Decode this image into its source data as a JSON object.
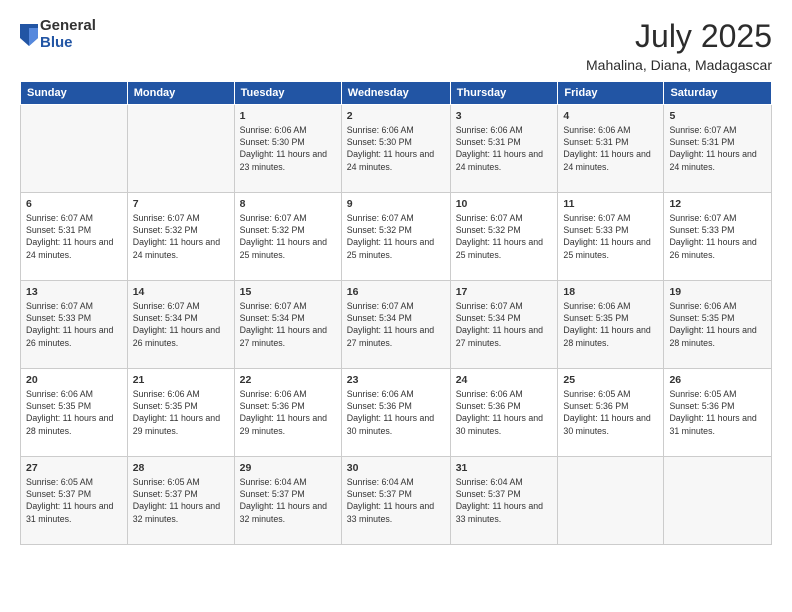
{
  "logo": {
    "general": "General",
    "blue": "Blue"
  },
  "header": {
    "month_year": "July 2025",
    "location": "Mahalina, Diana, Madagascar"
  },
  "weekdays": [
    "Sunday",
    "Monday",
    "Tuesday",
    "Wednesday",
    "Thursday",
    "Friday",
    "Saturday"
  ],
  "weeks": [
    [
      {
        "day": "",
        "info": ""
      },
      {
        "day": "",
        "info": ""
      },
      {
        "day": "1",
        "info": "Sunrise: 6:06 AM\nSunset: 5:30 PM\nDaylight: 11 hours and 23 minutes."
      },
      {
        "day": "2",
        "info": "Sunrise: 6:06 AM\nSunset: 5:30 PM\nDaylight: 11 hours and 24 minutes."
      },
      {
        "day": "3",
        "info": "Sunrise: 6:06 AM\nSunset: 5:31 PM\nDaylight: 11 hours and 24 minutes."
      },
      {
        "day": "4",
        "info": "Sunrise: 6:06 AM\nSunset: 5:31 PM\nDaylight: 11 hours and 24 minutes."
      },
      {
        "day": "5",
        "info": "Sunrise: 6:07 AM\nSunset: 5:31 PM\nDaylight: 11 hours and 24 minutes."
      }
    ],
    [
      {
        "day": "6",
        "info": "Sunrise: 6:07 AM\nSunset: 5:31 PM\nDaylight: 11 hours and 24 minutes."
      },
      {
        "day": "7",
        "info": "Sunrise: 6:07 AM\nSunset: 5:32 PM\nDaylight: 11 hours and 24 minutes."
      },
      {
        "day": "8",
        "info": "Sunrise: 6:07 AM\nSunset: 5:32 PM\nDaylight: 11 hours and 25 minutes."
      },
      {
        "day": "9",
        "info": "Sunrise: 6:07 AM\nSunset: 5:32 PM\nDaylight: 11 hours and 25 minutes."
      },
      {
        "day": "10",
        "info": "Sunrise: 6:07 AM\nSunset: 5:32 PM\nDaylight: 11 hours and 25 minutes."
      },
      {
        "day": "11",
        "info": "Sunrise: 6:07 AM\nSunset: 5:33 PM\nDaylight: 11 hours and 25 minutes."
      },
      {
        "day": "12",
        "info": "Sunrise: 6:07 AM\nSunset: 5:33 PM\nDaylight: 11 hours and 26 minutes."
      }
    ],
    [
      {
        "day": "13",
        "info": "Sunrise: 6:07 AM\nSunset: 5:33 PM\nDaylight: 11 hours and 26 minutes."
      },
      {
        "day": "14",
        "info": "Sunrise: 6:07 AM\nSunset: 5:34 PM\nDaylight: 11 hours and 26 minutes."
      },
      {
        "day": "15",
        "info": "Sunrise: 6:07 AM\nSunset: 5:34 PM\nDaylight: 11 hours and 27 minutes."
      },
      {
        "day": "16",
        "info": "Sunrise: 6:07 AM\nSunset: 5:34 PM\nDaylight: 11 hours and 27 minutes."
      },
      {
        "day": "17",
        "info": "Sunrise: 6:07 AM\nSunset: 5:34 PM\nDaylight: 11 hours and 27 minutes."
      },
      {
        "day": "18",
        "info": "Sunrise: 6:06 AM\nSunset: 5:35 PM\nDaylight: 11 hours and 28 minutes."
      },
      {
        "day": "19",
        "info": "Sunrise: 6:06 AM\nSunset: 5:35 PM\nDaylight: 11 hours and 28 minutes."
      }
    ],
    [
      {
        "day": "20",
        "info": "Sunrise: 6:06 AM\nSunset: 5:35 PM\nDaylight: 11 hours and 28 minutes."
      },
      {
        "day": "21",
        "info": "Sunrise: 6:06 AM\nSunset: 5:35 PM\nDaylight: 11 hours and 29 minutes."
      },
      {
        "day": "22",
        "info": "Sunrise: 6:06 AM\nSunset: 5:36 PM\nDaylight: 11 hours and 29 minutes."
      },
      {
        "day": "23",
        "info": "Sunrise: 6:06 AM\nSunset: 5:36 PM\nDaylight: 11 hours and 30 minutes."
      },
      {
        "day": "24",
        "info": "Sunrise: 6:06 AM\nSunset: 5:36 PM\nDaylight: 11 hours and 30 minutes."
      },
      {
        "day": "25",
        "info": "Sunrise: 6:05 AM\nSunset: 5:36 PM\nDaylight: 11 hours and 30 minutes."
      },
      {
        "day": "26",
        "info": "Sunrise: 6:05 AM\nSunset: 5:36 PM\nDaylight: 11 hours and 31 minutes."
      }
    ],
    [
      {
        "day": "27",
        "info": "Sunrise: 6:05 AM\nSunset: 5:37 PM\nDaylight: 11 hours and 31 minutes."
      },
      {
        "day": "28",
        "info": "Sunrise: 6:05 AM\nSunset: 5:37 PM\nDaylight: 11 hours and 32 minutes."
      },
      {
        "day": "29",
        "info": "Sunrise: 6:04 AM\nSunset: 5:37 PM\nDaylight: 11 hours and 32 minutes."
      },
      {
        "day": "30",
        "info": "Sunrise: 6:04 AM\nSunset: 5:37 PM\nDaylight: 11 hours and 33 minutes."
      },
      {
        "day": "31",
        "info": "Sunrise: 6:04 AM\nSunset: 5:37 PM\nDaylight: 11 hours and 33 minutes."
      },
      {
        "day": "",
        "info": ""
      },
      {
        "day": "",
        "info": ""
      }
    ]
  ]
}
